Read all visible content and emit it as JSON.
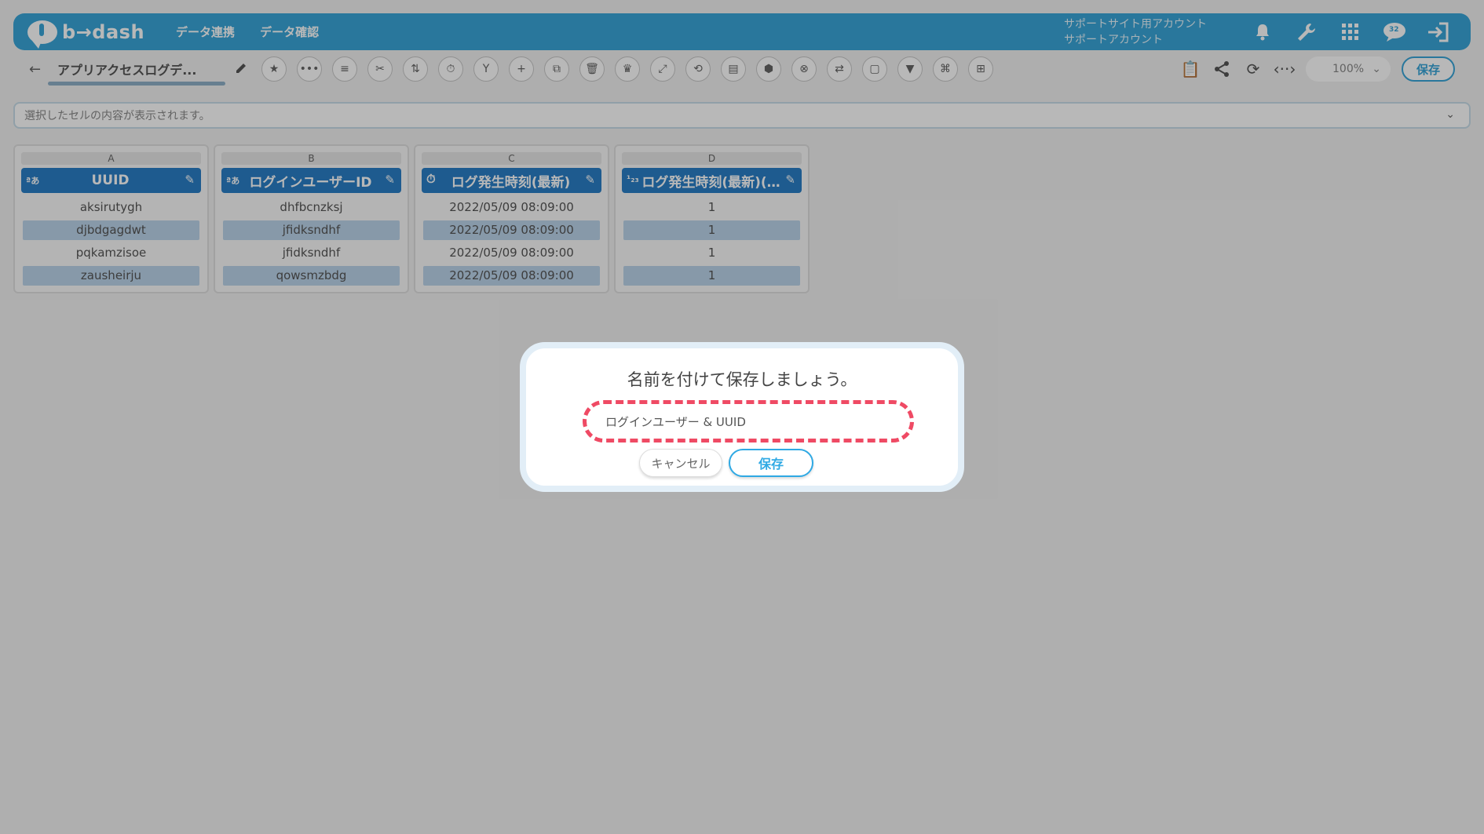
{
  "header": {
    "logo_text": "b→dash",
    "nav": [
      "データ連携",
      "データ確認"
    ],
    "account_line1": "サポートサイト用アカウント",
    "account_line2": "サポートアカウント",
    "notification_badge": "32"
  },
  "toolbar": {
    "back_label": "←",
    "doc_title": "アプリアクセスログデ...",
    "zoom_value": "100%",
    "save_label": "保存"
  },
  "cell_bar": {
    "placeholder": "選択したセルの内容が表示されます。"
  },
  "columns": [
    {
      "letter": "A",
      "type": "ªあ",
      "header": "UUID",
      "cells": [
        "aksirutygh",
        "djbdgagdwt",
        "pqkamzisoe",
        "zausheirju"
      ]
    },
    {
      "letter": "B",
      "type": "ªあ",
      "header": "ログインユーザーID",
      "cells": [
        "dhfbcnzksj",
        "jfidksndhf",
        "jfidksndhf",
        "qowsmzbdg"
      ]
    },
    {
      "letter": "C",
      "type": "⏱",
      "header": "ログ発生時刻(最新)",
      "cells": [
        "2022/05/09 08:09:00",
        "2022/05/09 08:09:00",
        "2022/05/09 08:09:00",
        "2022/05/09 08:09:00"
      ]
    },
    {
      "letter": "D",
      "type": "¹₂₃",
      "header": "ログ発生時刻(最新)(…",
      "cells": [
        "1",
        "1",
        "1",
        "1"
      ]
    }
  ],
  "modal": {
    "title": "名前を付けて保存しましょう。",
    "input_value": "ログインユーザー & UUID",
    "cancel_label": "キャンセル",
    "save_label": "保存"
  }
}
